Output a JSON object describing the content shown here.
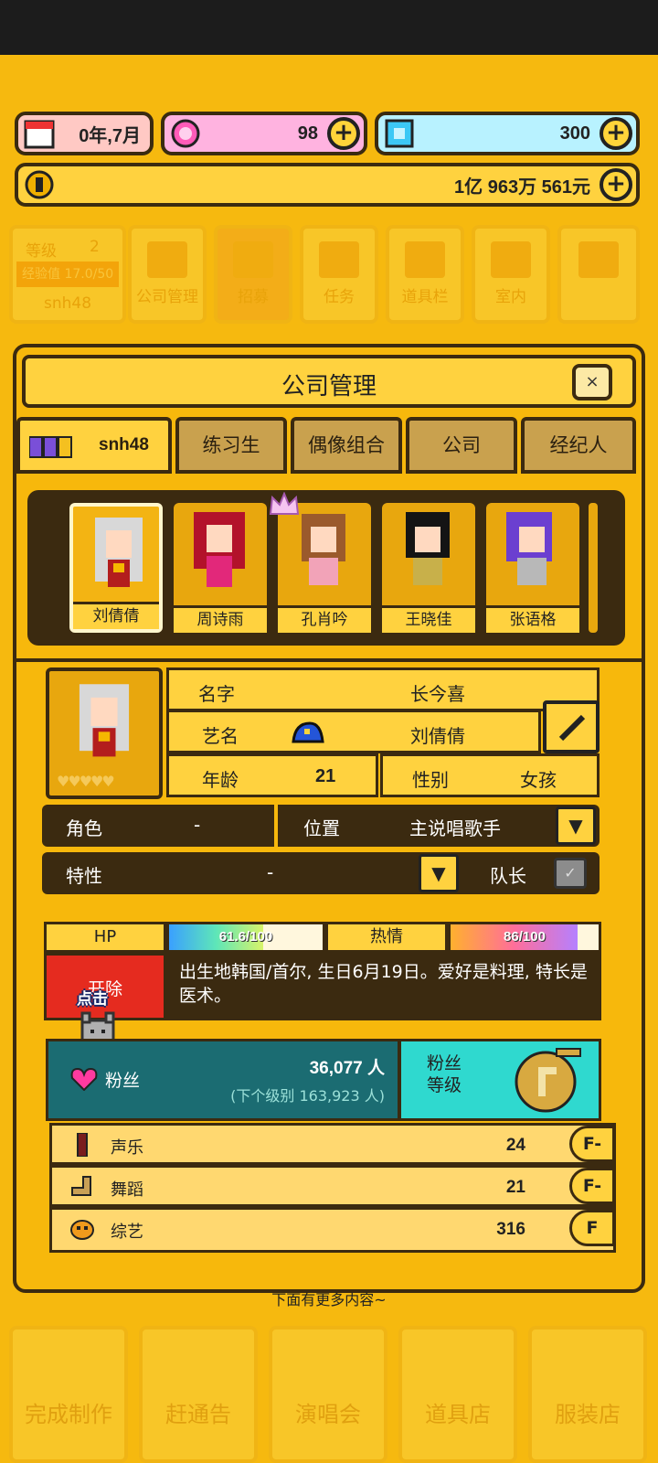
{
  "resources": {
    "date": "0年,7月",
    "gems": "98",
    "diamonds": "300",
    "money": "1亿 963万 561元"
  },
  "bg_menu": {
    "level_label": "等级",
    "level_value": "2",
    "exp_label": "经验值 17.0/50",
    "company": "snh48",
    "items": [
      "公司管理",
      "招募",
      "任务",
      "道具栏",
      "室内"
    ]
  },
  "panel": {
    "title": "公司管理",
    "close": "×",
    "tabs": [
      "snh48",
      "练习生",
      "偶像组合",
      "公司",
      "经纪人"
    ],
    "roster": [
      "刘倩倩",
      "周诗雨",
      "孔肖吟",
      "王晓佳",
      "张语格"
    ]
  },
  "profile": {
    "name_label": "名字",
    "name_value": "长今喜",
    "stage_label": "艺名",
    "stage_value": "刘倩倩",
    "age_label": "年龄",
    "age_value": "21",
    "gender_label": "性别",
    "gender_value": "女孩",
    "role_label": "角色",
    "role_value": "-",
    "position_label": "位置",
    "position_value": "主说唱歌手",
    "trait_label": "特性",
    "trait_value": "-",
    "leader_label": "队长",
    "hearts": 0
  },
  "stats": {
    "hp_label": "HP",
    "hp_text": "61.6/100",
    "hp_value": 61.6,
    "hp_max": 100,
    "passion_label": "热情",
    "passion_text": "86/100",
    "passion_value": 86,
    "passion_max": 100,
    "fire_label": "开除",
    "tap_label": "点击",
    "bio": "出生地韩国/首尔, 生日6月19日。爱好是料理, 特长是医术。",
    "fans_label": "粉丝",
    "fans_value": "36,077 人",
    "next_level": "(下个级别 163,923 人)",
    "fan_level_label": "粉丝\n等级"
  },
  "skills": [
    {
      "name": "声乐",
      "value": "24",
      "grade": "F-"
    },
    {
      "name": "舞蹈",
      "value": "21",
      "grade": "F-"
    },
    {
      "name": "综艺",
      "value": "316",
      "grade": "F"
    }
  ],
  "footer": {
    "more": "下面有更多内容~",
    "bottom_items": [
      "完成制作",
      "赶通告",
      "演唱会",
      "道具店",
      "服装店"
    ]
  },
  "colors": {
    "background": "#f6b90f",
    "dark_brown": "#3b2a10",
    "panel_yellow": "#ffd23f",
    "fire_red": "#e52b1f",
    "fan_teal": "#1b6c72",
    "fan_level_cyan": "#2fd9cf"
  }
}
